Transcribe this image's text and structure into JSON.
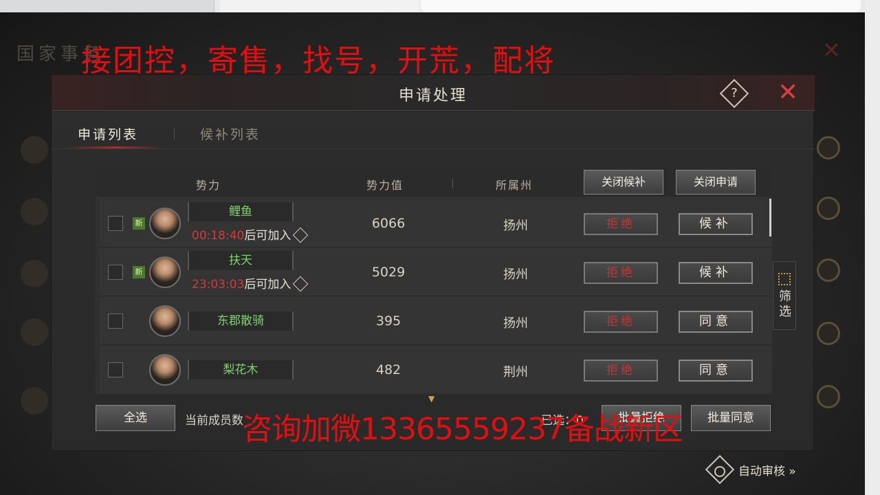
{
  "overlay": {
    "promo_top": "接团控，寄售，找号，开荒，配将",
    "promo_bottom": "咨询加微13365559237备战新区"
  },
  "background": {
    "title": "国家事务",
    "close_icon": "close-icon"
  },
  "dialog": {
    "title": "申请处理",
    "help_label": "?",
    "close_label": "✕",
    "tabs": [
      {
        "label": "申请列表",
        "active": true
      },
      {
        "label": "候补列表",
        "active": false
      }
    ]
  },
  "table": {
    "headers": {
      "faction": "势力",
      "power": "势力值",
      "state": "所属州"
    },
    "close_waitlist_label": "关闭候补",
    "close_apply_label": "关闭申请",
    "rows": [
      {
        "name": "鲤鱼",
        "new_badge": "新",
        "timer": "00:18:40",
        "timer_suffix": "后可加入",
        "power": "6066",
        "state": "扬州",
        "reject": "拒绝",
        "action": "候补"
      },
      {
        "name": "扶天",
        "new_badge": "新",
        "timer": "23:03:03",
        "timer_suffix": "后可加入",
        "power": "5029",
        "state": "扬州",
        "reject": "拒绝",
        "action": "候补"
      },
      {
        "name": "东郡散骑",
        "power": "395",
        "state": "扬州",
        "reject": "拒绝",
        "action": "同意"
      },
      {
        "name": "梨花木",
        "power": "482",
        "state": "荆州",
        "reject": "拒绝",
        "action": "同意"
      }
    ]
  },
  "filter": {
    "label": "筛选",
    "icon": "grid-icon"
  },
  "footer": {
    "select_all": "全选",
    "members_text": "当前成员数",
    "selected_text": "已选：0",
    "batch_reject": "批量拒绝",
    "batch_accept": "批量同意"
  },
  "auto_review": {
    "label": "自动审核 »",
    "icon": "gear-icon"
  },
  "colors": {
    "promo": "#e01010",
    "name_green": "#7ed36c",
    "reject_red": "#c93232",
    "timer_red": "#d13a3a"
  }
}
